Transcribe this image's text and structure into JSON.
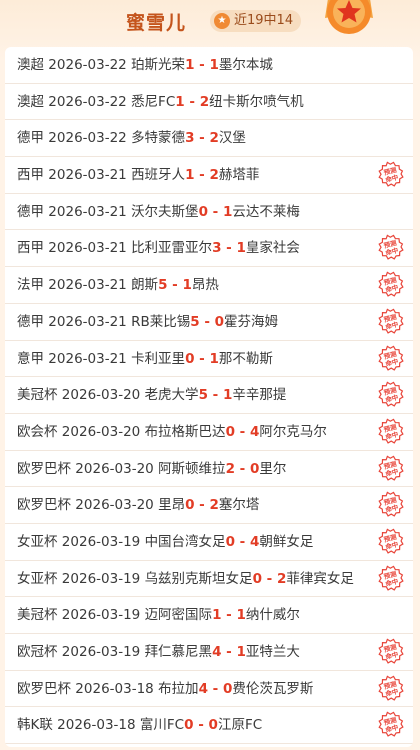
{
  "header": {
    "expert_name": "蜜雪儿",
    "streak": "近19中14"
  },
  "stamp_text": [
    "预测",
    "命中"
  ],
  "matches": [
    {
      "league": "澳超",
      "date": "2026-03-22",
      "home": "珀斯光荣",
      "home_score": "1",
      "sep": " - ",
      "away_score": "1",
      "away": "墨尔本城",
      "hit": false
    },
    {
      "league": "澳超",
      "date": "2026-03-22",
      "home": "悉尼FC",
      "home_score": "1",
      "sep": " - ",
      "away_score": "2",
      "away": "纽卡斯尔喷气机",
      "hit": false
    },
    {
      "league": "德甲",
      "date": "2026-03-22",
      "home": "多特蒙德",
      "home_score": "3",
      "sep": " - ",
      "away_score": "2",
      "away": "汉堡",
      "hit": false
    },
    {
      "league": "西甲",
      "date": "2026-03-21",
      "home": "西班牙人",
      "home_score": "1",
      "sep": " - ",
      "away_score": "2",
      "away": "赫塔菲",
      "hit": true
    },
    {
      "league": "德甲",
      "date": "2026-03-21",
      "home": "沃尔夫斯堡",
      "home_score": "0",
      "sep": " - ",
      "away_score": "1",
      "away": "云达不莱梅",
      "hit": false
    },
    {
      "league": "西甲",
      "date": "2026-03-21",
      "home": "比利亚雷亚尔",
      "home_score": "3",
      "sep": " - ",
      "away_score": "1",
      "away": "皇家社会",
      "hit": true
    },
    {
      "league": "法甲",
      "date": "2026-03-21",
      "home": "朗斯",
      "home_score": "5",
      "sep": " - ",
      "away_score": "1",
      "away": "昂热",
      "hit": true
    },
    {
      "league": "德甲",
      "date": "2026-03-21",
      "home": "RB莱比锡",
      "home_score": "5",
      "sep": " - ",
      "away_score": "0",
      "away": "霍芬海姆",
      "hit": true
    },
    {
      "league": "意甲",
      "date": "2026-03-21",
      "home": "卡利亚里",
      "home_score": "0",
      "sep": " - ",
      "away_score": "1",
      "away": "那不勒斯",
      "hit": true
    },
    {
      "league": "美冠杯",
      "date": "2026-03-20",
      "home": "老虎大学",
      "home_score": "5",
      "sep": " - ",
      "away_score": "1",
      "away": "辛辛那提",
      "hit": true
    },
    {
      "league": "欧会杯",
      "date": "2026-03-20",
      "home": "布拉格斯巴达",
      "home_score": "0",
      "sep": " - ",
      "away_score": "4",
      "away": "阿尔克马尔",
      "hit": true
    },
    {
      "league": "欧罗巴杯",
      "date": "2026-03-20",
      "home": "阿斯顿维拉",
      "home_score": "2",
      "sep": " - ",
      "away_score": "0",
      "away": "里尔",
      "hit": true
    },
    {
      "league": "欧罗巴杯",
      "date": "2026-03-20",
      "home": "里昂",
      "home_score": "0",
      "sep": " - ",
      "away_score": "2",
      "away": "塞尔塔",
      "hit": true
    },
    {
      "league": "女亚杯",
      "date": "2026-03-19",
      "home": "中国台湾女足",
      "home_score": "0",
      "sep": " - ",
      "away_score": "4",
      "away": "朝鲜女足",
      "hit": true
    },
    {
      "league": "女亚杯",
      "date": "2026-03-19",
      "home": "乌兹别克斯坦女足",
      "home_score": "0",
      "sep": " - ",
      "away_score": "2",
      "away": "菲律宾女足",
      "hit": true
    },
    {
      "league": "美冠杯",
      "date": "2026-03-19",
      "home": "迈阿密国际",
      "home_score": "1",
      "sep": " - ",
      "away_score": "1",
      "away": "纳什威尔",
      "hit": false
    },
    {
      "league": "欧冠杯",
      "date": "2026-03-19",
      "home": "拜仁慕尼黑",
      "home_score": "4",
      "sep": " - ",
      "away_score": "1",
      "away": "亚特兰大",
      "hit": true
    },
    {
      "league": "欧罗巴杯",
      "date": "2026-03-18",
      "home": "布拉加",
      "home_score": "4",
      "sep": " - ",
      "away_score": "0",
      "away": "费伦茨瓦罗斯",
      "hit": true
    },
    {
      "league": "韩K联",
      "date": "2026-03-18",
      "home": "富川FC",
      "home_score": "0",
      "sep": " - ",
      "away_score": "0",
      "away": "江原FC",
      "hit": true
    }
  ]
}
